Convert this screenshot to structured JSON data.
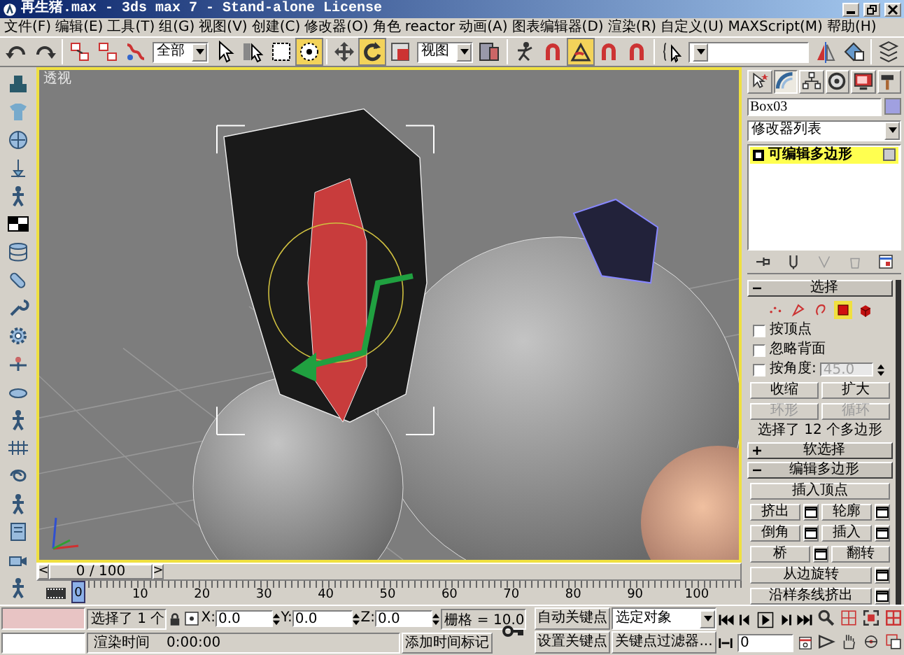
{
  "window": {
    "title": "再生猪.max - 3ds max 7  - Stand-alone License"
  },
  "menu": [
    "文件(F)",
    "编辑(E)",
    "工具(T)",
    "组(G)",
    "视图(V)",
    "创建(C)",
    "修改器(O)",
    "角色",
    "reactor",
    "动画(A)",
    "图表编辑器(D)",
    "渲染(R)",
    "自定义(U)",
    "MAXScript(M)",
    "帮助(H)"
  ],
  "toolbar": [
    {
      "kind": "button",
      "selected": false
    },
    {
      "kind": "button",
      "selected": false
    },
    {
      "kind": "separator"
    },
    {
      "kind": "button",
      "selected": false
    },
    {
      "kind": "button",
      "selected": false
    },
    {
      "kind": "button",
      "selected": false
    },
    {
      "kind": "dropdown",
      "value": "全部"
    },
    {
      "kind": "button",
      "selected": false
    },
    {
      "kind": "button",
      "selected": false
    },
    {
      "kind": "button",
      "selected": false
    },
    {
      "kind": "button",
      "selected": true
    },
    {
      "kind": "separator"
    },
    {
      "kind": "button",
      "selected": false
    },
    {
      "kind": "button",
      "selected": true
    },
    {
      "kind": "button",
      "selected": false
    },
    {
      "kind": "dropdown",
      "value": "视图"
    },
    {
      "kind": "button",
      "selected": false
    },
    {
      "kind": "separator"
    },
    {
      "kind": "button",
      "selected": false
    },
    {
      "kind": "button",
      "selected": false
    },
    {
      "kind": "button",
      "selected": true
    },
    {
      "kind": "button",
      "selected": false
    },
    {
      "kind": "button",
      "selected": false
    },
    {
      "kind": "separator"
    },
    {
      "kind": "button",
      "selected": false
    },
    {
      "kind": "dropdown"
    },
    {
      "kind": "button",
      "selected": false
    },
    {
      "kind": "button",
      "selected": false
    },
    {
      "kind": "separator"
    },
    {
      "kind": "button",
      "selected": false
    }
  ],
  "viewport": {
    "label": "透视",
    "active": true
  },
  "time_slider": {
    "prev": "<",
    "position": "0 / 100",
    "next": ">",
    "level": 0
  },
  "track_bar": {
    "current": "0",
    "labels": [
      "10",
      "20",
      "30",
      "40",
      "50",
      "60",
      "70",
      "80",
      "90",
      "100"
    ]
  },
  "command_panel": {
    "tabs": [
      {
        "selected": false
      },
      {
        "selected": true
      },
      {
        "selected": false
      },
      {
        "selected": false
      },
      {
        "selected": false
      },
      {
        "selected": false
      }
    ],
    "object_name": "Box03",
    "modifier_list": "修改器列表",
    "stack": [
      {
        "label": "可编辑多边形",
        "selected": true
      }
    ],
    "rollouts": [
      {
        "kind": "selection",
        "title": "选择",
        "expanded": true,
        "sub_levels": [
          {
            "selected": false
          },
          {
            "selected": false
          },
          {
            "selected": false
          },
          {
            "selected": true
          },
          {
            "selected": false
          }
        ],
        "options": [
          {
            "label": "按顶点",
            "checked": false
          },
          {
            "label": "忽略背面",
            "checked": false
          },
          {
            "label": "按角度:",
            "checked": false,
            "value": "45.0",
            "disabled": true
          }
        ],
        "rows": [
          [
            {
              "label": "收缩",
              "disabled": false
            },
            {
              "label": "扩大",
              "disabled": false
            }
          ],
          [
            {
              "label": "环形",
              "disabled": true
            },
            {
              "label": "循环",
              "disabled": true
            }
          ]
        ],
        "status": "选择了 12 个多边形"
      },
      {
        "kind": "soft",
        "title": "软选择",
        "expanded": false
      },
      {
        "kind": "edit",
        "title": "编辑多边形",
        "expanded": true,
        "rows": [
          [
            {
              "label": "插入顶点",
              "settings": false
            }
          ],
          [
            {
              "label": "挤出",
              "settings": true
            },
            {
              "label": "轮廓",
              "settings": true
            }
          ],
          [
            {
              "label": "倒角",
              "settings": true
            },
            {
              "label": "插入",
              "settings": true
            }
          ],
          [
            {
              "label": "桥",
              "settings": true
            },
            {
              "label": "翻转",
              "settings": false
            }
          ],
          [
            {
              "label": "从边旋转",
              "settings": true
            }
          ],
          [
            {
              "label": "沿样条线挤出",
              "settings": true
            }
          ]
        ]
      }
    ]
  },
  "status_bar": {
    "selection": "选择了 1 个",
    "coords": [
      {
        "axis": "X:",
        "value": "0.0"
      },
      {
        "axis": "Y:",
        "value": "0.0"
      },
      {
        "axis": "Z:",
        "value": "0.0"
      }
    ],
    "grid": "栅格 = 10.0",
    "render_time_label": "渲染时间",
    "render_time": "0:00:00",
    "add_time_tag": "添加时间标记"
  },
  "animation": {
    "auto_key": {
      "label": "自动关键点",
      "on": false
    },
    "key_set": "选定对象",
    "set_key": "设置关键点",
    "key_filters": "关键点过滤器...",
    "frame": "0"
  }
}
